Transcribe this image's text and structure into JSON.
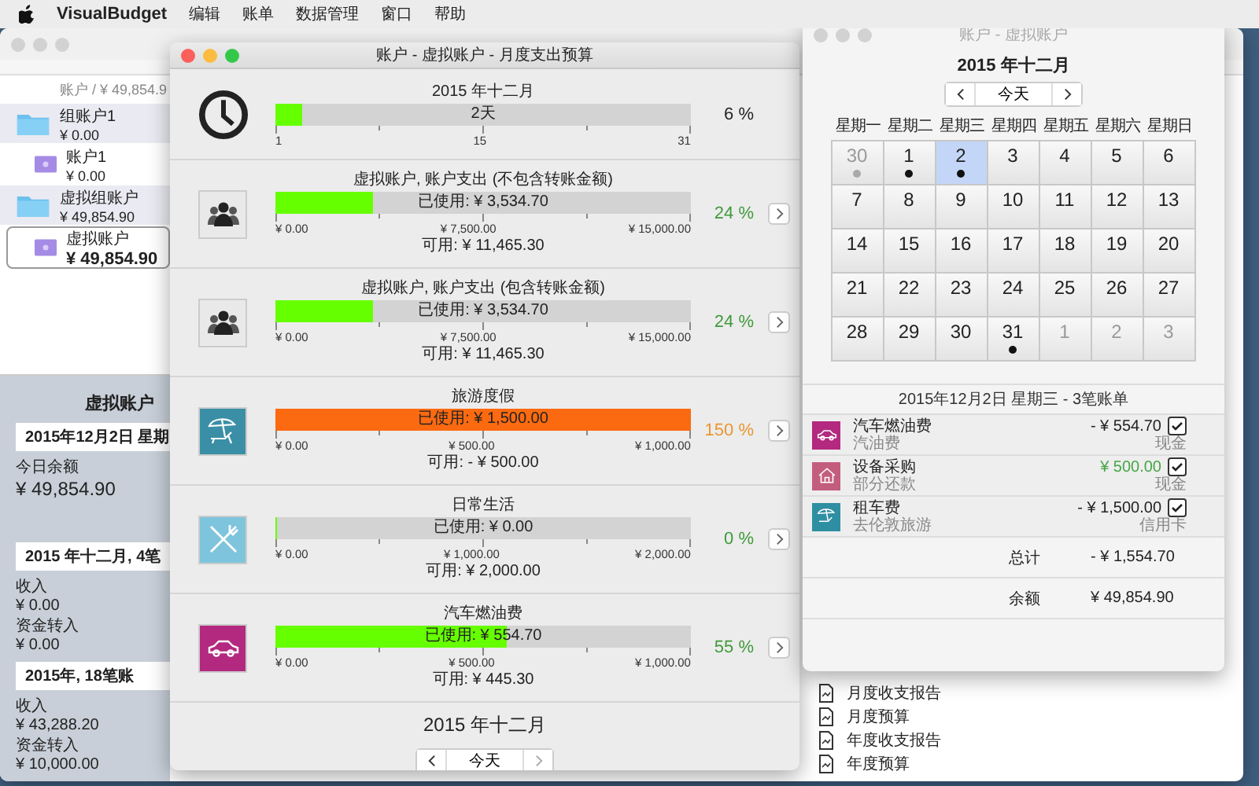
{
  "menu_bar": {
    "app_name": "VisualBudget",
    "items": [
      "编辑",
      "账单",
      "数据管理",
      "窗口",
      "帮助"
    ]
  },
  "main_window": {
    "sidebar": {
      "header": "账户 / ¥ 49,854.9",
      "accounts": [
        {
          "name": "组账户1",
          "balance": "¥ 0.00",
          "kind": "group",
          "selected": false,
          "children": [
            {
              "name": "账户1",
              "balance": "¥ 0.00",
              "kind": "account",
              "selected": false
            }
          ]
        },
        {
          "name": "虚拟组账户",
          "balance": "¥ 49,854.90",
          "kind": "group",
          "selected": false,
          "children": [
            {
              "name": "虚拟账户",
              "balance": "¥ 49,854.90",
              "kind": "account",
              "selected": true
            }
          ]
        }
      ]
    },
    "summary": {
      "title": "虚拟账户",
      "sections": [
        {
          "heading": "2015年12月2日 星期",
          "rows": [
            {
              "label": "今日余额",
              "value": "¥ 49,854.90"
            }
          ]
        },
        {
          "heading": "2015 年十二月, 4笔",
          "rows": [
            {
              "label": "收入",
              "value": "¥ 0.00"
            },
            {
              "label": "资金转入",
              "value": "¥ 0.00"
            }
          ]
        },
        {
          "heading": "2015年, 18笔账",
          "rows": [
            {
              "label": "收入",
              "value": "¥ 43,288.20"
            },
            {
              "label": "资金转入",
              "value": "¥ 10,000.00"
            }
          ]
        }
      ]
    },
    "reports": [
      "月度收支报告",
      "月度预算",
      "年度收支报告",
      "年度预算"
    ]
  },
  "budget_window": {
    "title": "账户 - 虚拟账户 - 月度支出预算",
    "period": {
      "title": "2015 年十二月",
      "level": 0.065,
      "bar_label": "2天",
      "ticks": [
        "1",
        "15",
        "31"
      ],
      "percent": "6 %"
    },
    "budgets": [
      {
        "title": "虚拟账户, 账户支出 (不包含转账金额)",
        "kind": "people",
        "color": "#e9e9e9",
        "level": 0.236,
        "over_budget": false,
        "bar_label": "已使用:  ¥ 3,534.70",
        "ticks": [
          "¥ 0.00",
          "¥ 7,500.00",
          "¥ 15,000.00"
        ],
        "available": "可用:  ¥ 11,465.30",
        "percent": "24 %"
      },
      {
        "title": "虚拟账户, 账户支出 (包含转账金额)",
        "kind": "people",
        "color": "#e9e9e9",
        "level": 0.236,
        "over_budget": false,
        "bar_label": "已使用:  ¥ 3,534.70",
        "ticks": [
          "¥ 0.00",
          "¥ 7,500.00",
          "¥ 15,000.00"
        ],
        "available": "可用:  ¥ 11,465.30",
        "percent": "24 %"
      },
      {
        "title": "旅游度假",
        "kind": "beach",
        "color": "#3a8fa6",
        "level": 1,
        "over_budget": true,
        "bar_label": "已使用:  ¥ 1,500.00",
        "ticks": [
          "¥ 0.00",
          "¥ 500.00",
          "¥ 1,000.00"
        ],
        "available": "可用:  - ¥ 500.00",
        "percent": "150 %"
      },
      {
        "title": "日常生活",
        "kind": "cutlery",
        "color": "#7fc4dd",
        "level": 0,
        "over_budget": false,
        "bar_label": "已使用:  ¥ 0.00",
        "ticks": [
          "¥ 0.00",
          "¥ 1,000.00",
          "¥ 2,000.00"
        ],
        "available": "可用:  ¥ 2,000.00",
        "percent": "0 %"
      },
      {
        "title": "汽车燃油费",
        "kind": "car",
        "color": "#b3297f",
        "level": 0.555,
        "over_budget": false,
        "bar_label": "已使用:  ¥ 554.70",
        "ticks": [
          "¥ 0.00",
          "¥ 500.00",
          "¥ 1,000.00"
        ],
        "available": "可用:  ¥ 445.30",
        "percent": "55 %"
      }
    ],
    "footer": {
      "month": "2015 年十二月",
      "today_button": "今天"
    }
  },
  "calendar_window": {
    "title": "账户 - 虚拟账户",
    "month": "2015 年十二月",
    "today_button": "今天",
    "weekdays": [
      "星期一",
      "星期二",
      "星期三",
      "星期四",
      "星期五",
      "星期六",
      "星期日"
    ],
    "weeks": [
      [
        {
          "day": "30",
          "in_month": false,
          "has_entries": true,
          "selected": false
        },
        {
          "day": "1",
          "in_month": true,
          "has_entries": true,
          "selected": false
        },
        {
          "day": "2",
          "in_month": true,
          "has_entries": true,
          "selected": true
        },
        {
          "day": "3",
          "in_month": true,
          "has_entries": false,
          "selected": false
        },
        {
          "day": "4",
          "in_month": true,
          "has_entries": false,
          "selected": false
        },
        {
          "day": "5",
          "in_month": true,
          "has_entries": false,
          "selected": false
        },
        {
          "day": "6",
          "in_month": true,
          "has_entries": false,
          "selected": false
        }
      ],
      [
        {
          "day": "7",
          "in_month": true,
          "has_entries": false,
          "selected": false
        },
        {
          "day": "8",
          "in_month": true,
          "has_entries": false,
          "selected": false
        },
        {
          "day": "9",
          "in_month": true,
          "has_entries": false,
          "selected": false
        },
        {
          "day": "10",
          "in_month": true,
          "has_entries": false,
          "selected": false
        },
        {
          "day": "11",
          "in_month": true,
          "has_entries": false,
          "selected": false
        },
        {
          "day": "12",
          "in_month": true,
          "has_entries": false,
          "selected": false
        },
        {
          "day": "13",
          "in_month": true,
          "has_entries": false,
          "selected": false
        }
      ],
      [
        {
          "day": "14",
          "in_month": true,
          "has_entries": false,
          "selected": false
        },
        {
          "day": "15",
          "in_month": true,
          "has_entries": false,
          "selected": false
        },
        {
          "day": "16",
          "in_month": true,
          "has_entries": false,
          "selected": false
        },
        {
          "day": "17",
          "in_month": true,
          "has_entries": false,
          "selected": false
        },
        {
          "day": "18",
          "in_month": true,
          "has_entries": false,
          "selected": false
        },
        {
          "day": "19",
          "in_month": true,
          "has_entries": false,
          "selected": false
        },
        {
          "day": "20",
          "in_month": true,
          "has_entries": false,
          "selected": false
        }
      ],
      [
        {
          "day": "21",
          "in_month": true,
          "has_entries": false,
          "selected": false
        },
        {
          "day": "22",
          "in_month": true,
          "has_entries": false,
          "selected": false
        },
        {
          "day": "23",
          "in_month": true,
          "has_entries": false,
          "selected": false
        },
        {
          "day": "24",
          "in_month": true,
          "has_entries": false,
          "selected": false
        },
        {
          "day": "25",
          "in_month": true,
          "has_entries": false,
          "selected": false
        },
        {
          "day": "26",
          "in_month": true,
          "has_entries": false,
          "selected": false
        },
        {
          "day": "27",
          "in_month": true,
          "has_entries": false,
          "selected": false
        }
      ],
      [
        {
          "day": "28",
          "in_month": true,
          "has_entries": false,
          "selected": false
        },
        {
          "day": "29",
          "in_month": true,
          "has_entries": false,
          "selected": false
        },
        {
          "day": "30",
          "in_month": true,
          "has_entries": false,
          "selected": false
        },
        {
          "day": "31",
          "in_month": true,
          "has_entries": true,
          "selected": false
        },
        {
          "day": "1",
          "in_month": false,
          "has_entries": false,
          "selected": false
        },
        {
          "day": "2",
          "in_month": false,
          "has_entries": false,
          "selected": false
        },
        {
          "day": "3",
          "in_month": false,
          "has_entries": false,
          "selected": false
        }
      ]
    ],
    "transactions": {
      "heading": "2015年12月2日 星期三 - 3笔账单",
      "items": [
        {
          "title": "汽车燃油费",
          "note": "汽油费",
          "amount": "- ¥ 554.70",
          "account": "现金",
          "income": false,
          "checked": true,
          "kind": "car",
          "color": "#b3297f"
        },
        {
          "title": "设备采购",
          "note": "部分还款",
          "amount": "¥ 500.00",
          "account": "现金",
          "income": true,
          "checked": true,
          "kind": "house",
          "color": "#c35d7e"
        },
        {
          "title": "租车费",
          "note": "去伦敦旅游",
          "amount": "- ¥ 1,500.00",
          "account": "信用卡",
          "income": false,
          "checked": true,
          "kind": "beach",
          "color": "#2f8fa2"
        }
      ]
    },
    "totals": [
      {
        "label": "总计",
        "value": "- ¥ 1,554.70"
      },
      {
        "label": "余额",
        "value": "¥ 49,854.90"
      }
    ]
  }
}
